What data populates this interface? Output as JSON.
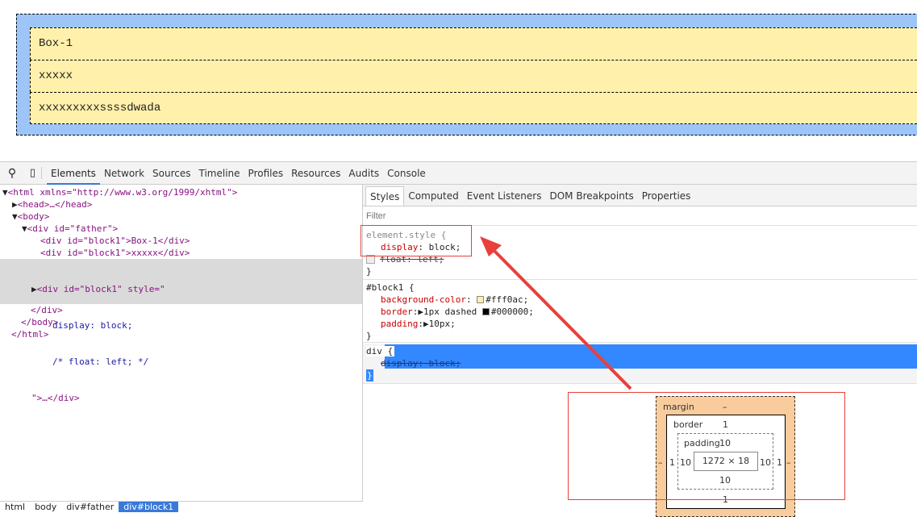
{
  "preview": {
    "blocks": [
      "Box-1",
      "xxxxx",
      "xxxxxxxxxssssdwada"
    ],
    "colors": {
      "father_bg": "#9ec5f8",
      "block_bg": "#fff0ac"
    }
  },
  "toolbar": {
    "icons": [
      "search-icon",
      "device-mode-icon"
    ],
    "tabs": [
      "Elements",
      "Network",
      "Sources",
      "Timeline",
      "Profiles",
      "Resources",
      "Audits",
      "Console"
    ],
    "active": "Elements"
  },
  "dom": {
    "l0": "<html xmlns=\"http://www.w3.org/1999/xhtml\">",
    "l1": "<head>…</head>",
    "l2": "<body>",
    "l3": "<div id=\"father\">",
    "l4": "<div id=\"block1\">Box-1</div>",
    "l5": "<div id=\"block1\">xxxxx</div>",
    "l6": "<div id=\"block1\" style=\"",
    "l7": "display: block;",
    "l8": "/* float: left; */",
    "l9": "\">…</div>",
    "l10": "</div>",
    "l11": "</body>",
    "l12": "</html>"
  },
  "breadcrumbs": [
    "html",
    "body",
    "div#father",
    "div#block1"
  ],
  "styles": {
    "tabs": [
      "Styles",
      "Computed",
      "Event Listeners",
      "DOM Breakpoints",
      "Properties"
    ],
    "active": "Styles",
    "filter_placeholder": "Filter",
    "element_style": {
      "selector": "element.style {",
      "p1": "display",
      "v1": "block;",
      "p2": "float: left;",
      "close": "}"
    },
    "block1": {
      "selector": "#block1 {",
      "p1": "background-color",
      "v1": "#fff0ac;",
      "p2": "border",
      "v2": "1px dashed",
      "v2b": "#000000;",
      "p3": "padding",
      "v3": "10px;",
      "close": "}"
    },
    "div": {
      "selector": "div {",
      "p1": "display: block;",
      "close": "}"
    }
  },
  "box_model": {
    "margin_label": "margin",
    "margin": "–",
    "border_label": "border",
    "border": "1",
    "padding_label": "padding",
    "padding": "10",
    "content": "1272 × 18",
    "left_margin": "–",
    "left_border": "1",
    "left_padding": "10",
    "right_padding": "10",
    "right_border": "1",
    "right_margin": "–",
    "bottom_padding": "10",
    "bottom_border": "1"
  },
  "annotation_color": "#e8403c"
}
